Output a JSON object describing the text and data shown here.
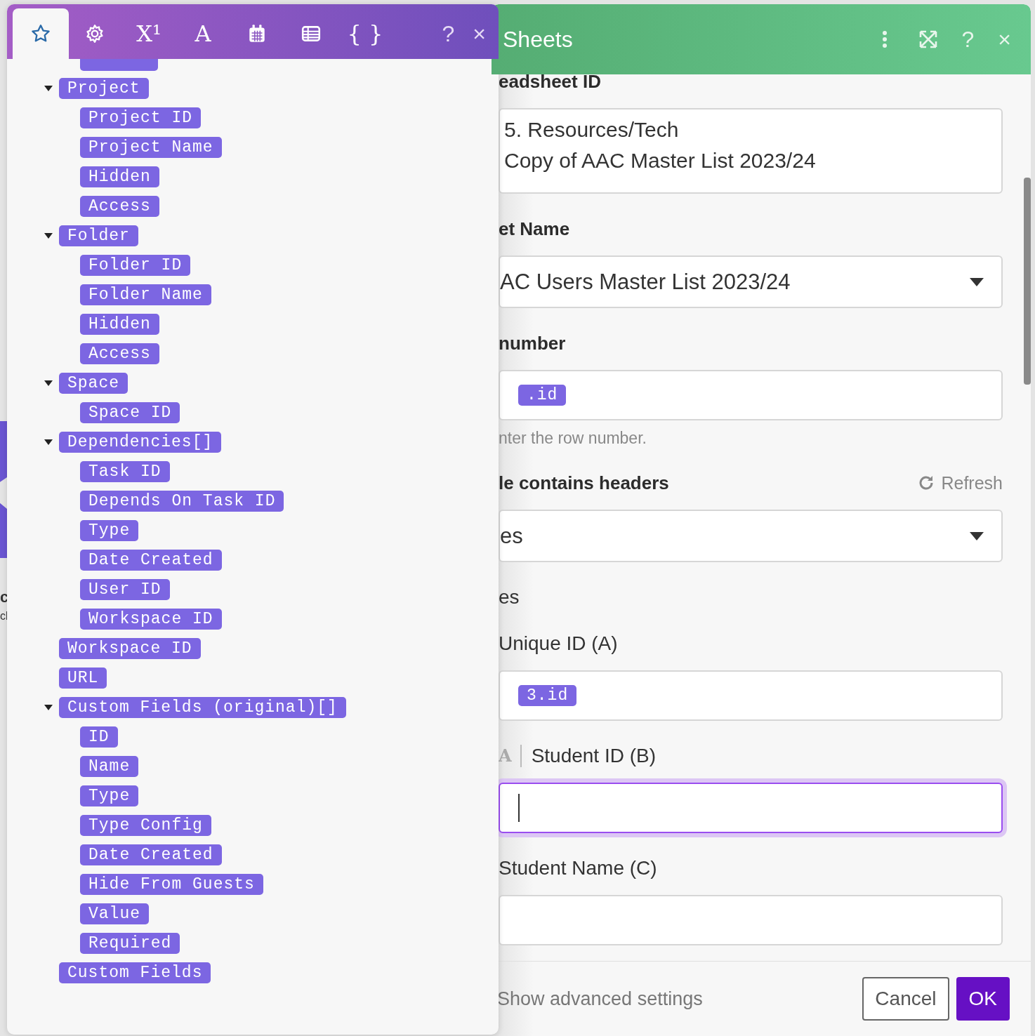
{
  "canvas": {
    "fragments": [
      {
        "text": "c",
        "bold": true
      },
      {
        "text": "cl",
        "bold": false
      }
    ]
  },
  "mapping_panel": {
    "tabs": [
      {
        "kind": "star",
        "selected": true
      },
      {
        "kind": "gear",
        "selected": false
      },
      {
        "glyph": "X¹",
        "selected": false
      },
      {
        "glyph": "A",
        "selected": false
      },
      {
        "kind": "calendar",
        "selected": false
      },
      {
        "kind": "table",
        "selected": false
      },
      {
        "glyph": "{ }",
        "selected": false
      }
    ],
    "actions": [
      "?",
      "×"
    ],
    "tree": [
      {
        "label": "Project",
        "expanded": true,
        "children": [
          {
            "label": "Project ID"
          },
          {
            "label": "Project Name"
          },
          {
            "label": "Hidden"
          },
          {
            "label": "Access"
          }
        ]
      },
      {
        "label": "Folder",
        "expanded": true,
        "children": [
          {
            "label": "Folder ID"
          },
          {
            "label": "Folder Name"
          },
          {
            "label": "Hidden"
          },
          {
            "label": "Access"
          }
        ]
      },
      {
        "label": "Space",
        "expanded": true,
        "children": [
          {
            "label": "Space ID"
          }
        ]
      },
      {
        "label": "Dependencies[]",
        "expanded": true,
        "children": [
          {
            "label": "Task ID"
          },
          {
            "label": "Depends On Task ID"
          },
          {
            "label": "Type"
          },
          {
            "label": "Date Created"
          },
          {
            "label": "User ID"
          },
          {
            "label": "Workspace ID"
          }
        ]
      },
      {
        "label": "Workspace ID"
      },
      {
        "label": "URL"
      },
      {
        "label": "Custom Fields (original)[]",
        "expanded": true,
        "children": [
          {
            "label": "ID"
          },
          {
            "label": "Name"
          },
          {
            "label": "Type"
          },
          {
            "label": "Type Config"
          },
          {
            "label": "Date Created"
          },
          {
            "label": "Hide From Guests"
          },
          {
            "label": "Value"
          },
          {
            "label": "Required"
          }
        ]
      },
      {
        "label": "Custom Fields"
      }
    ]
  },
  "sheets_panel": {
    "title": "Sheets",
    "actions": [
      "?",
      "×"
    ],
    "sections": [
      {
        "kind": "label",
        "text": "eadsheet ID",
        "bold": true
      },
      {
        "kind": "textarea",
        "lines": [
          "5. Resources/Tech",
          "Copy of AAC Master List 2023/24"
        ]
      },
      {
        "kind": "label",
        "text": "et Name",
        "bold": true
      },
      {
        "kind": "select",
        "value": "AC Users Master List 2023/24"
      },
      {
        "kind": "label",
        "text": "number",
        "bold": true
      },
      {
        "kind": "field",
        "chips": [
          ".id"
        ],
        "focused": false
      },
      {
        "kind": "hint",
        "text": "nter the row number."
      },
      {
        "kind": "label",
        "text": "le contains headers",
        "bold": true,
        "action": "Refresh"
      },
      {
        "kind": "select",
        "value": "es"
      },
      {
        "kind": "label",
        "text": "es",
        "bold": false
      },
      {
        "kind": "label",
        "text": "Unique ID (A)",
        "bold": false
      },
      {
        "kind": "field",
        "chips": [
          "3.id"
        ],
        "focused": false
      },
      {
        "kind": "label",
        "text": "Student ID (B)",
        "bold": false,
        "type_glyph": "A"
      },
      {
        "kind": "field",
        "focused": true
      },
      {
        "kind": "label",
        "text": "Student Name (C)",
        "bold": false
      },
      {
        "kind": "field",
        "focused": false
      }
    ],
    "advanced_link": "Show advanced settings",
    "buttons": [
      {
        "label": "Cancel",
        "kind": "secondary"
      },
      {
        "label": "OK",
        "kind": "primary"
      }
    ]
  }
}
